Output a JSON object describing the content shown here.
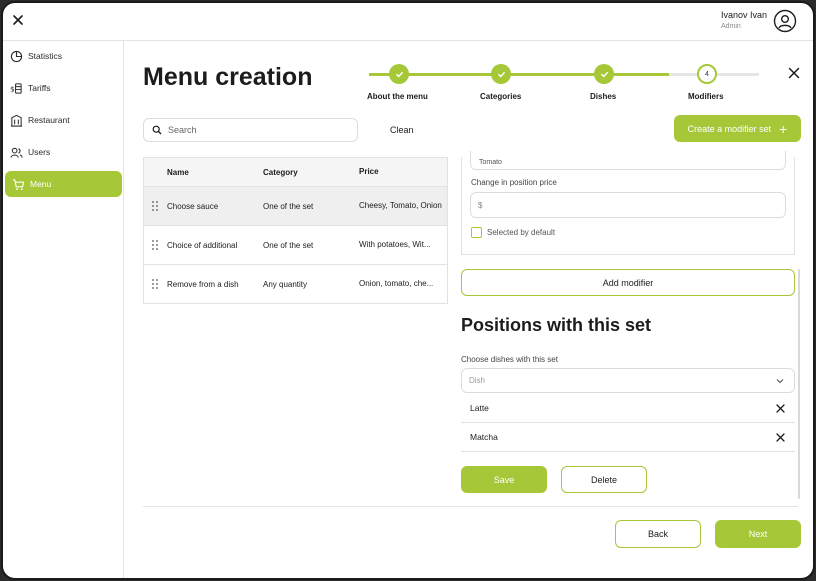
{
  "colors": {
    "accent": "#a6c838",
    "text": "#1c1c1c",
    "border": "#dcdcdc"
  },
  "topbar": {
    "close_icon": "close-icon",
    "user_name": "Ivanov Ivan",
    "user_role": "Admin",
    "avatar_icon": "user-circle-icon"
  },
  "sidebar": {
    "items": [
      {
        "label": "Statistics",
        "icon": "pie-chart-icon",
        "active": false
      },
      {
        "label": "Tariffs",
        "icon": "money-icon",
        "active": false
      },
      {
        "label": "Restaurant",
        "icon": "building-icon",
        "active": false
      },
      {
        "label": "Users",
        "icon": "users-icon",
        "active": false
      },
      {
        "label": "Menu",
        "icon": "cart-icon",
        "active": true
      }
    ]
  },
  "main": {
    "title": "Menu creation",
    "steps": [
      {
        "label": "About the menu",
        "state": "done"
      },
      {
        "label": "Categories",
        "state": "done"
      },
      {
        "label": "Dishes",
        "state": "done"
      },
      {
        "label": "Modifiers",
        "state": "current",
        "number": "4"
      }
    ],
    "search_placeholder": "Search",
    "clean_label": "Clean",
    "create_label": "Create a modifier set",
    "create_plus": "+"
  },
  "table": {
    "headers": {
      "name": "Name",
      "category": "Category",
      "price": "Price"
    },
    "rows": [
      {
        "name": "Choose sauce",
        "category": "One of the set",
        "price": "Cheesy, Tomato, Onion"
      },
      {
        "name": "Choice of additional",
        "category": "One of the set",
        "price": "With potatoes, Wit..."
      },
      {
        "name": "Remove from a dish",
        "category": "Any quantity",
        "price": "Onion, tomato, che..."
      }
    ]
  },
  "panel": {
    "modifier_value": "Tomato",
    "price_label": "Change in position price",
    "price_placeholder": "$",
    "selected_default_label": "Selected by default",
    "add_modifier_label": "Add modifier",
    "positions_title": "Positions with this set",
    "choose_label": "Choose dishes with this set",
    "dish_placeholder": "Dish",
    "dishes": [
      "Latte",
      "Matcha"
    ],
    "save_label": "Save",
    "delete_label": "Delete"
  },
  "footer": {
    "back_label": "Back",
    "next_label": "Next"
  }
}
